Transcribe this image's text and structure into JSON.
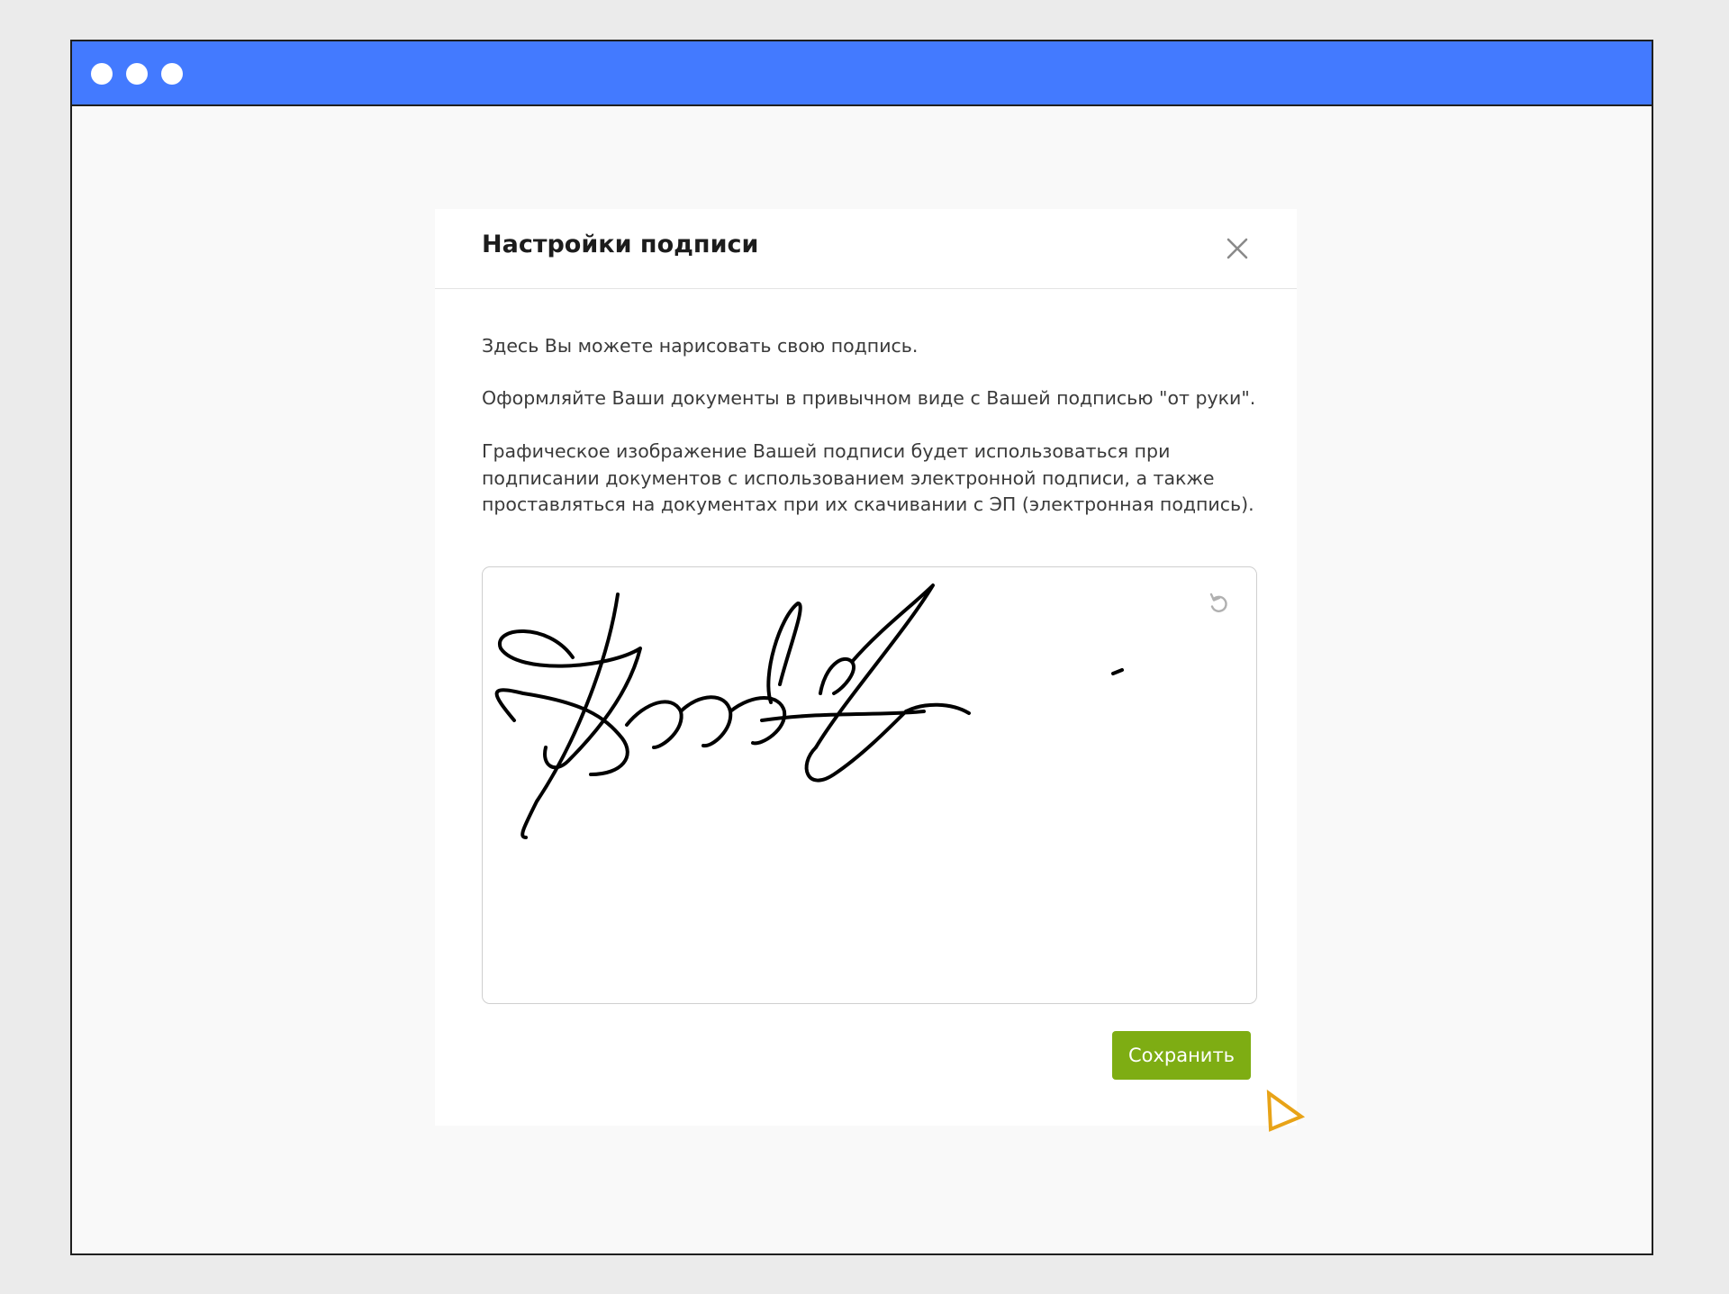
{
  "window": {
    "titlebar_color": "#437aff",
    "controls": [
      "window-dot",
      "window-dot",
      "window-dot"
    ]
  },
  "dialog": {
    "title": "Настройки подписи",
    "close_icon": "close-icon",
    "paragraphs": {
      "intro": "Здесь Вы можете нарисовать свою подпись.",
      "usage": "Оформляйте Ваши документы в привычном виде с Вашей подписью \"от руки\".",
      "details": "Графическое изображение Вашей подписи будет использоваться при подписании документов с использованием электронной подписи, а также проставляться на документах при их скачивании с ЭП (электронная подпись)."
    },
    "signature_pad": {
      "undo_icon": "undo-icon",
      "stroke_color": "#000000"
    },
    "save_label": "Сохранить",
    "save_color": "#7ead13"
  },
  "cursor": {
    "icon": "pointer-cursor-icon",
    "color": "#e8a317"
  }
}
